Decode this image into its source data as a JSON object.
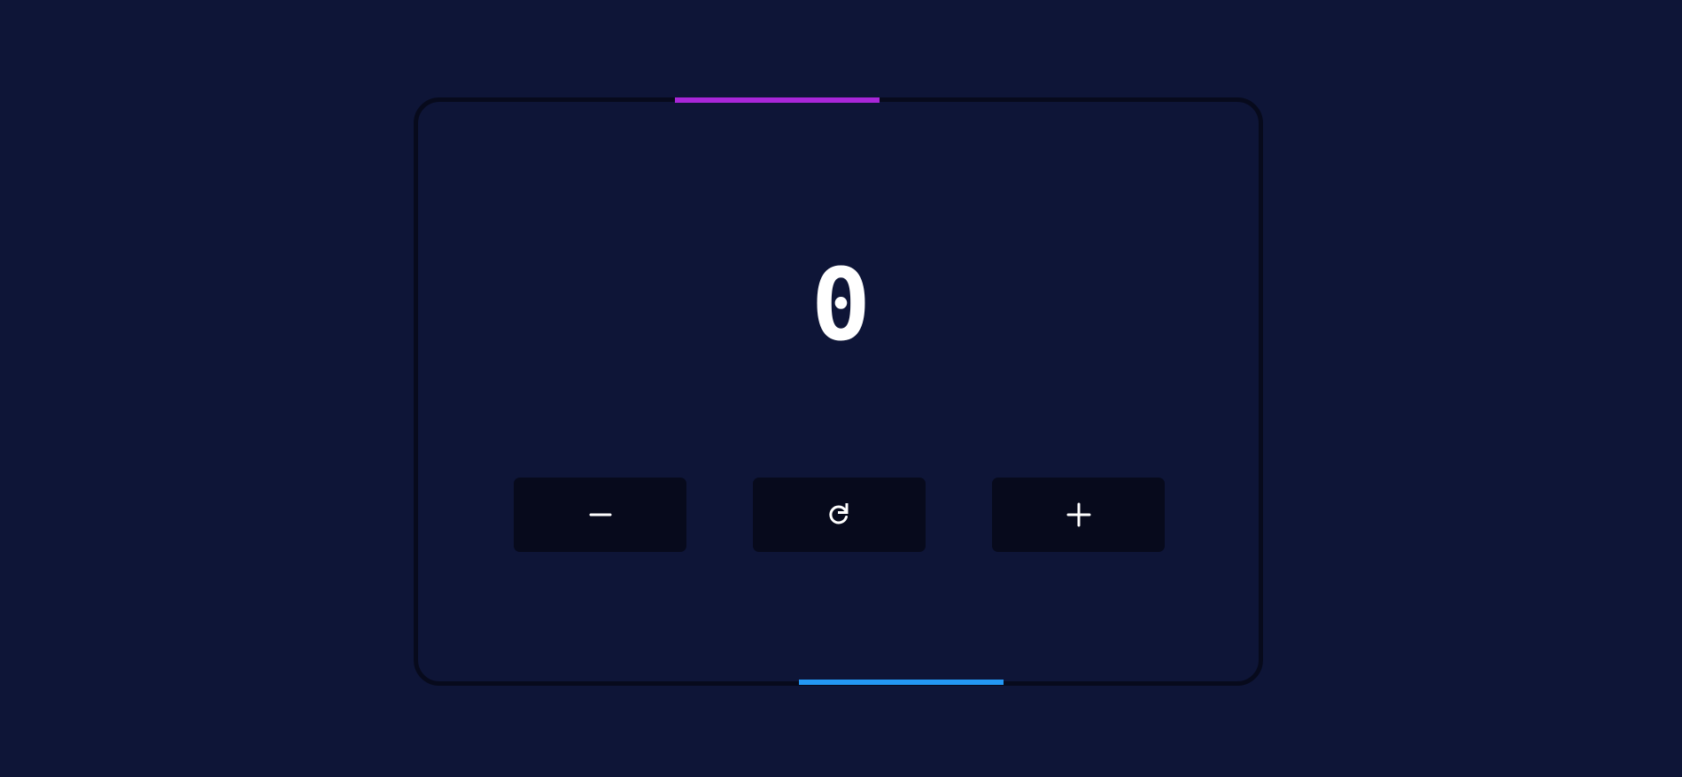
{
  "counter": {
    "value": "0"
  },
  "buttons": {
    "decrement": {
      "icon": "minus-icon"
    },
    "reset": {
      "icon": "refresh-icon"
    },
    "increment": {
      "icon": "plus-icon"
    }
  },
  "colors": {
    "background": "#0e1537",
    "card_border": "#070a1c",
    "button_bg": "#070a1c",
    "accent_top": "#a826d8",
    "accent_bottom": "#2397f3",
    "text": "#ffffff"
  }
}
